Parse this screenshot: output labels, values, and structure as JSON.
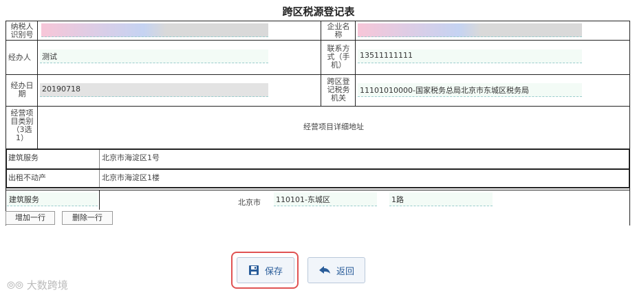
{
  "title": "跨区税源登记表",
  "labels": {
    "taxpayer_id": [
      "纳税人",
      "识别号"
    ],
    "company_name": [
      "企业名",
      "称"
    ],
    "handler": "经办人",
    "contact": [
      "联系方",
      "式（手",
      "机）"
    ],
    "handle_date": [
      "经办日",
      "期"
    ],
    "tax_authority": [
      "跨区登",
      "记税务",
      "机关"
    ],
    "category": [
      "经营项",
      "目类别",
      "（3选",
      "1）"
    ],
    "detail_address": "经营项目详细地址"
  },
  "values": {
    "taxpayer_id": "",
    "company_name": "",
    "handler": "测试",
    "contact": "13511111111",
    "handle_date": "20190718",
    "tax_authority": "11101010000-国家税务总局北京市东城区税务局"
  },
  "rows": [
    {
      "category": "建筑服务",
      "address": "北京市海淀区1号"
    },
    {
      "category": "出租不动产",
      "address": "北京市海淀区1楼"
    }
  ],
  "edit_row": {
    "category": "建筑服务",
    "city": "北京市",
    "district": "110101-东城区",
    "street": "1路"
  },
  "buttons": {
    "add_row": "增加一行",
    "delete_row": "删除一行",
    "save": "保存",
    "back": "返回"
  },
  "watermark": "大数跨境",
  "colors": {
    "save_border": "#e05252",
    "accent": "#2a5d9a"
  }
}
